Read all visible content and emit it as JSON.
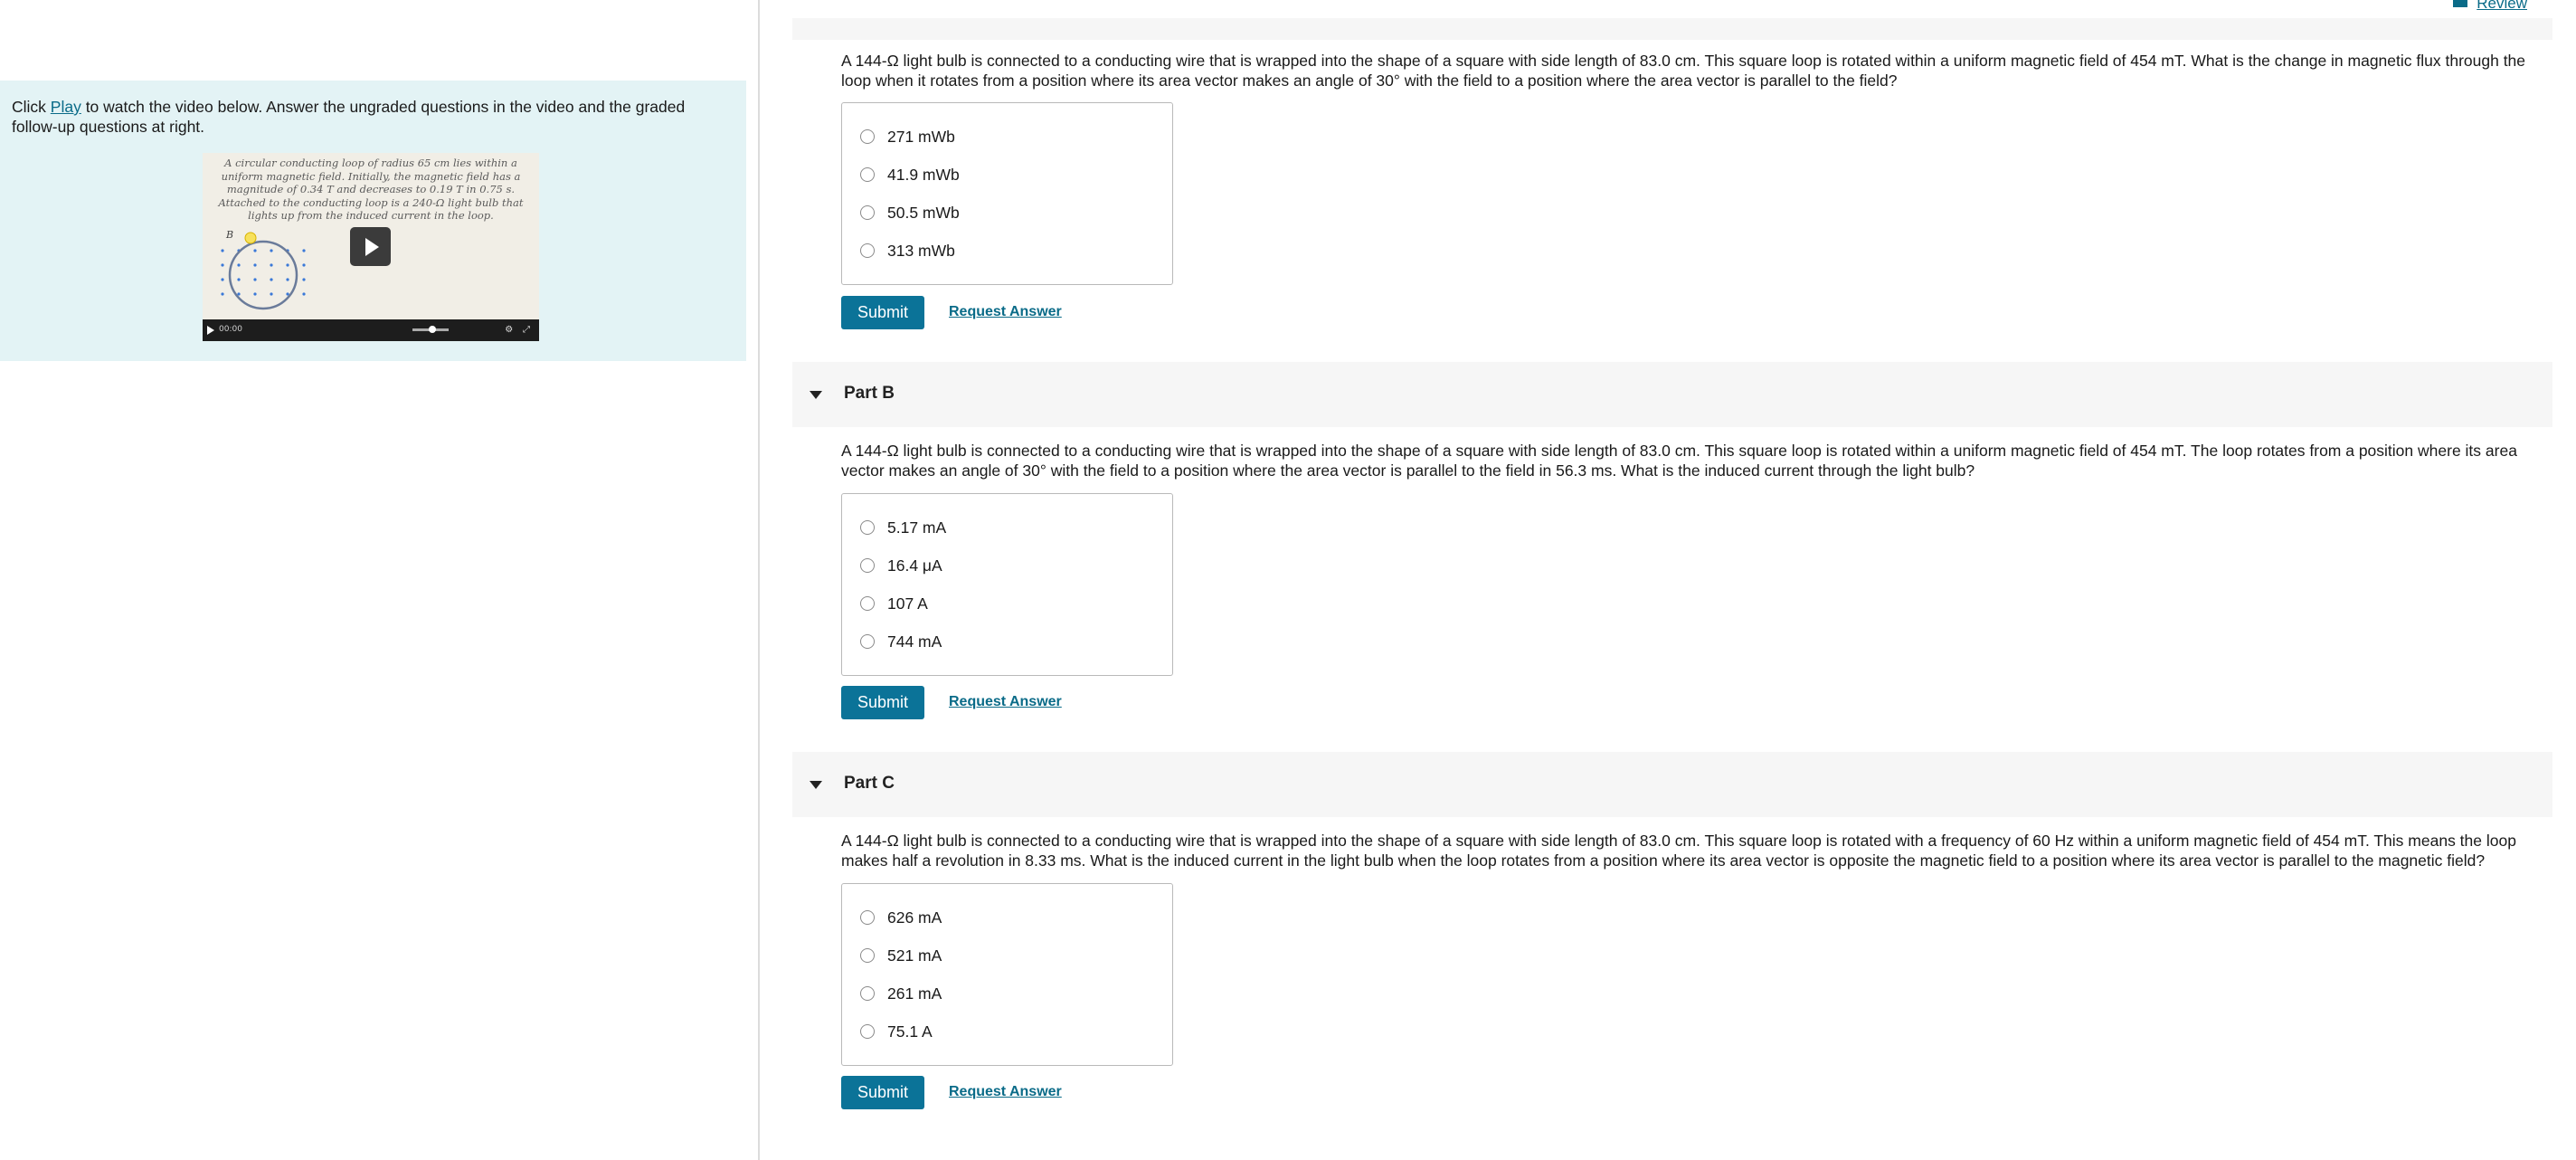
{
  "left": {
    "instructions_prefix": "Click ",
    "play_link": "Play",
    "instructions_suffix": " to watch the video below. Answer the ungraded questions in the video and the graded follow-up questions at right.",
    "video": {
      "caption": "A circular conducting loop of radius 65 cm lies within a uniform magnetic field. Initially, the magnetic field has a magnitude of 0.34 T and decreases to 0.19 T in 0.75 s. Attached to the conducting loop is a 240-Ω light bulb that lights up from the induced current in the loop.",
      "field_label": "B",
      "time": "00:00"
    }
  },
  "header": {
    "review_label": "Review"
  },
  "parts": [
    {
      "question": "A 144-Ω light bulb is connected to a conducting wire that is wrapped into the shape of a square with side length of 83.0 cm. This square loop is rotated within a uniform magnetic field of 454 mT. What is the change in magnetic flux through the loop when it rotates from a position where its area vector makes an angle of 30° with the field to a position where the area vector is parallel to the field?",
      "choices": [
        "271 mWb",
        "41.9 mWb",
        "50.5 mWb",
        "313 mWb"
      ],
      "submit": "Submit",
      "request": "Request Answer"
    },
    {
      "title": "Part B",
      "question": "A 144-Ω light bulb is connected to a conducting wire that is wrapped into the shape of a square with side length of 83.0 cm. This square loop is rotated within a uniform magnetic field of 454 mT. The loop rotates from a position where its area vector makes an angle of 30° with the field to a position where the area vector is parallel to the field in 56.3 ms. What is the induced current through the light bulb?",
      "choices": [
        "5.17 mA",
        "16.4 μA",
        "107 A",
        "744 mA"
      ],
      "submit": "Submit",
      "request": "Request Answer"
    },
    {
      "title": "Part C",
      "question": "A 144-Ω light bulb is connected to a conducting wire that is wrapped into the shape of a square with side length of 83.0 cm. This square loop is rotated with a frequency of 60 Hz within a uniform magnetic field of 454 mT. This means the loop makes half a revolution in 8.33 ms. What is the induced current in the light bulb when the loop rotates from a position where its area vector is opposite the magnetic field to a position where its area vector is parallel to the magnetic field?",
      "choices": [
        "626 mA",
        "521 mA",
        "261 mA",
        "75.1 A"
      ],
      "submit": "Submit",
      "request": "Request Answer"
    }
  ],
  "colors": {
    "accent": "#0b7398",
    "link": "#0a6b88",
    "info_bg": "#e3f3f5",
    "header_bg": "#f6f6f6"
  }
}
